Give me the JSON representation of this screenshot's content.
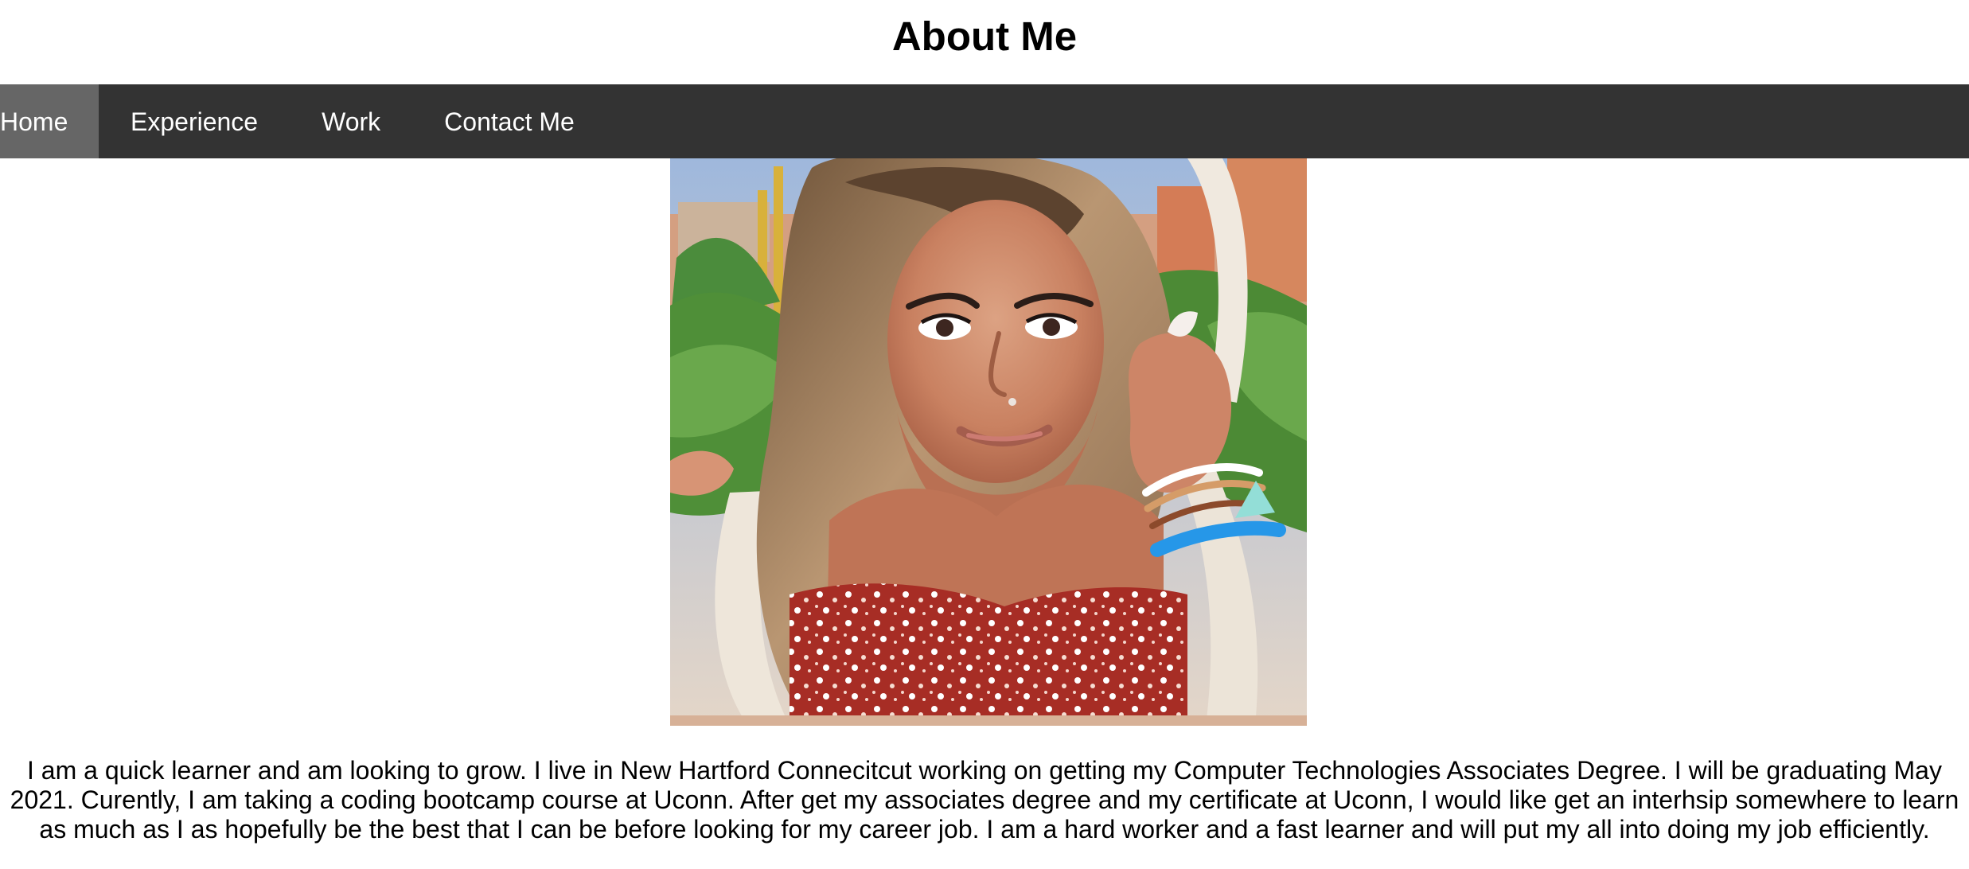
{
  "header": {
    "title": "About Me"
  },
  "nav": {
    "items": [
      {
        "label": "Home",
        "active": true
      },
      {
        "label": "Experience",
        "active": false
      },
      {
        "label": "Work",
        "active": false
      },
      {
        "label": "Contact Me",
        "active": false
      }
    ]
  },
  "main": {
    "bio": "I am a quick learner and am looking to grow. I live in New Hartford Connecitcut working on getting my Computer Technologies Associates Degree. I will be graduating May 2021. Curently, I am taking a coding bootcamp course at Uconn. After get my associates degree and my certificate at Uconn, I would like get an interhsip somewhere to learn as much as I as hopefully be the best that I can be before looking for my career job. I am a hard worker and a fast learner and will put my all into doing my job efficiently."
  },
  "colors": {
    "navbar_background": "#333333",
    "active_nav_background": "#666666",
    "nav_text": "#ffffff",
    "body_text": "#000000"
  }
}
